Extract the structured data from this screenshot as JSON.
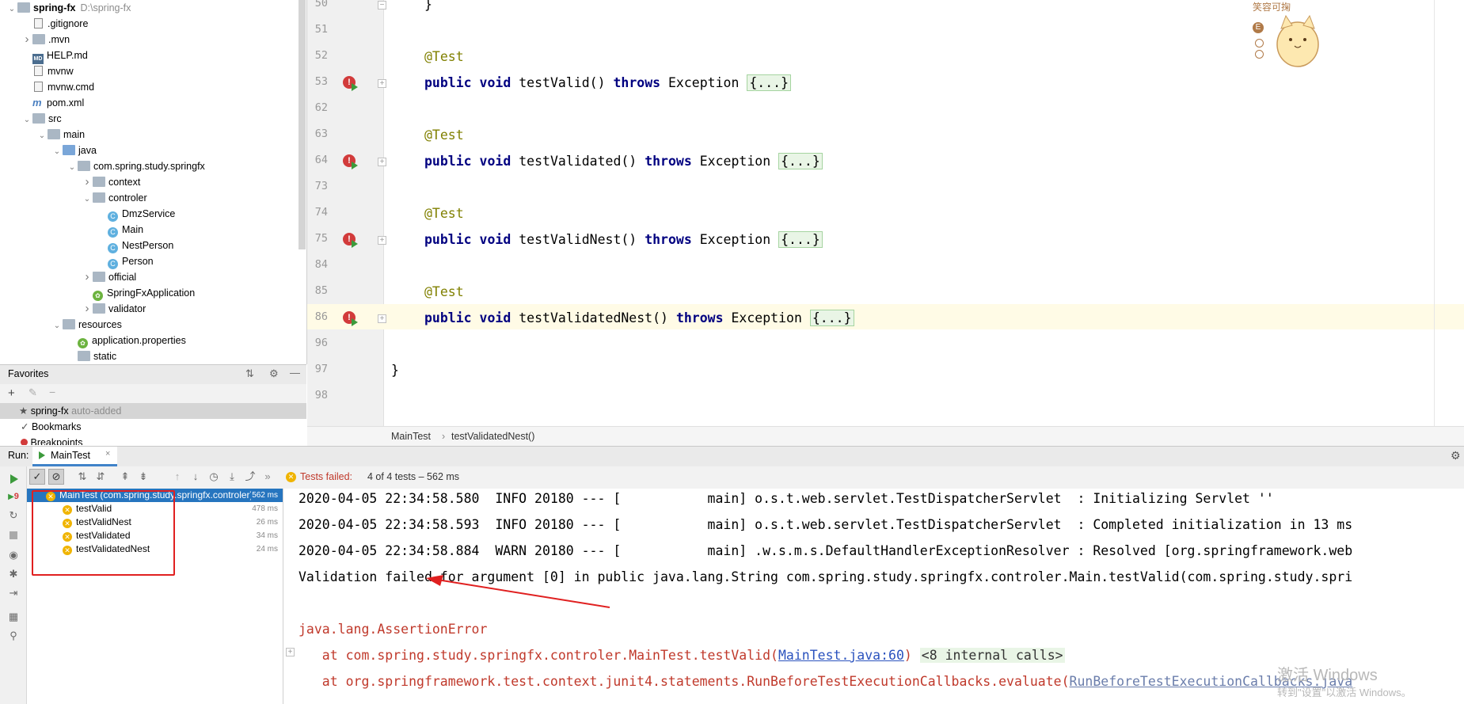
{
  "project_tree": [
    {
      "label": "spring-fx",
      "extra": "D:\\spring-fx",
      "depth": 0,
      "expand": "open",
      "icon": "folder"
    },
    {
      "label": ".gitignore",
      "depth": 1,
      "expand": "",
      "icon": "file"
    },
    {
      "label": ".mvn",
      "depth": 1,
      "expand": "closed",
      "icon": "folder"
    },
    {
      "label": "HELP.md",
      "depth": 1,
      "expand": "",
      "icon": "md"
    },
    {
      "label": "mvnw",
      "depth": 1,
      "expand": "",
      "icon": "file"
    },
    {
      "label": "mvnw.cmd",
      "depth": 1,
      "expand": "",
      "icon": "file"
    },
    {
      "label": "pom.xml",
      "depth": 1,
      "expand": "",
      "icon": "maven"
    },
    {
      "label": "src",
      "depth": 1,
      "expand": "open",
      "icon": "folder"
    },
    {
      "label": "main",
      "depth": 2,
      "expand": "open",
      "icon": "folder"
    },
    {
      "label": "java",
      "depth": 3,
      "expand": "open",
      "icon": "folder-blue"
    },
    {
      "label": "com.spring.study.springfx",
      "depth": 4,
      "expand": "open",
      "icon": "folder"
    },
    {
      "label": "context",
      "depth": 5,
      "expand": "closed",
      "icon": "folder"
    },
    {
      "label": "controler",
      "depth": 5,
      "expand": "open",
      "icon": "folder"
    },
    {
      "label": "DmzService",
      "depth": 6,
      "expand": "",
      "icon": "class"
    },
    {
      "label": "Main",
      "depth": 6,
      "expand": "",
      "icon": "class"
    },
    {
      "label": "NestPerson",
      "depth": 6,
      "expand": "",
      "icon": "class"
    },
    {
      "label": "Person",
      "depth": 6,
      "expand": "",
      "icon": "class"
    },
    {
      "label": "official",
      "depth": 5,
      "expand": "closed",
      "icon": "folder"
    },
    {
      "label": "SpringFxApplication",
      "depth": 5,
      "expand": "",
      "icon": "spring"
    },
    {
      "label": "validator",
      "depth": 5,
      "expand": "closed",
      "icon": "folder"
    },
    {
      "label": "resources",
      "depth": 3,
      "expand": "open",
      "icon": "folder"
    },
    {
      "label": "application.properties",
      "depth": 4,
      "expand": "",
      "icon": "spring"
    },
    {
      "label": "static",
      "depth": 4,
      "expand": "",
      "icon": "folder"
    }
  ],
  "favorites": {
    "title": "Favorites",
    "items": [
      {
        "label": "spring-fx",
        "extra": "auto-added",
        "icon": "star"
      },
      {
        "label": "Bookmarks",
        "extra": "",
        "icon": "check"
      },
      {
        "label": "Breakpoints",
        "extra": "",
        "icon": "dot"
      }
    ]
  },
  "editor": {
    "lines": [
      {
        "num": "50",
        "code": "}",
        "kind": "plain",
        "fold": "-",
        "indent": 2
      },
      {
        "num": "51",
        "code": "",
        "kind": "plain",
        "fold": "",
        "indent": 0
      },
      {
        "num": "52",
        "code": "@Test",
        "kind": "ann",
        "fold": "",
        "indent": 1
      },
      {
        "num": "53",
        "code": "testValid",
        "kind": "method",
        "fold": "+",
        "indent": 1,
        "error": true
      },
      {
        "num": "62",
        "code": "",
        "kind": "plain",
        "fold": "",
        "indent": 0
      },
      {
        "num": "63",
        "code": "@Test",
        "kind": "ann",
        "fold": "",
        "indent": 1
      },
      {
        "num": "64",
        "code": "testValidated",
        "kind": "method",
        "fold": "+",
        "indent": 1,
        "error": true
      },
      {
        "num": "73",
        "code": "",
        "kind": "plain",
        "fold": "",
        "indent": 0
      },
      {
        "num": "74",
        "code": "@Test",
        "kind": "ann",
        "fold": "",
        "indent": 1
      },
      {
        "num": "75",
        "code": "testValidNest",
        "kind": "method",
        "fold": "+",
        "indent": 1,
        "error": true
      },
      {
        "num": "84",
        "code": "",
        "kind": "plain",
        "fold": "",
        "indent": 0
      },
      {
        "num": "85",
        "code": "@Test",
        "kind": "ann",
        "fold": "",
        "indent": 1
      },
      {
        "num": "86",
        "code": "testValidatedNest",
        "kind": "method",
        "fold": "+",
        "indent": 1,
        "error": true
      },
      {
        "num": "96",
        "code": "",
        "kind": "plain",
        "fold": "",
        "indent": 0
      },
      {
        "num": "97",
        "code": "}",
        "kind": "plain",
        "fold": "",
        "indent": 0
      },
      {
        "num": "98",
        "code": "",
        "kind": "plain",
        "fold": "",
        "indent": 0
      }
    ],
    "kw_public": "public",
    "kw_void": "void",
    "kw_throws": "throws",
    "exception": "Exception",
    "folded": "{...}",
    "mascot_text": "笑容可掬",
    "mascot_badge": "E"
  },
  "breadcrumb": {
    "class": "MainTest",
    "method": "testValidatedNest()"
  },
  "run": {
    "label": "Run:",
    "tab": "MainTest",
    "status": "Tests failed:",
    "status_detail": "4 of 4 tests – 562 ms",
    "side_badge": "9"
  },
  "test_tree": [
    {
      "label": "MainTest (com.spring.study.springfx.controler)",
      "time": "562 ms",
      "root": true
    },
    {
      "label": "testValid",
      "time": "478 ms",
      "root": false
    },
    {
      "label": "testValidNest",
      "time": "26 ms",
      "root": false
    },
    {
      "label": "testValidated",
      "time": "34 ms",
      "root": false
    },
    {
      "label": "testValidatedNest",
      "time": "24 ms",
      "root": false
    }
  ],
  "console": {
    "log1": "2020-04-05 22:34:58.580  INFO 20180 --- [           main] o.s.t.web.servlet.TestDispatcherServlet  : Initializing Servlet ''",
    "log2": "2020-04-05 22:34:58.593  INFO 20180 --- [           main] o.s.t.web.servlet.TestDispatcherServlet  : Completed initialization in 13 ms",
    "log3": "2020-04-05 22:34:58.884  WARN 20180 --- [           main] .w.s.m.s.DefaultHandlerExceptionResolver : Resolved [org.springframework.web",
    "log4": "Validation failed for argument [0] in public java.lang.String com.spring.study.springfx.controler.Main.testValid(com.spring.study.spri",
    "error": "java.lang.AssertionError",
    "at1_prefix": "   at com.spring.study.springfx.controler.MainTest.testValid(",
    "at1_link": "MainTest.java:60",
    "at1_suffix": ")",
    "at1_internal": "<8 internal calls>",
    "at2_prefix": "   at org.springframework.test.context.junit4.statements.RunBeforeTestExecutionCallbacks.evaluate(",
    "at2_link": "RunBeforeTestExecutionCallbacks.java"
  },
  "watermark": {
    "line1": "激活 Windows",
    "line2": "转到\"设置\"以激活 Windows。"
  },
  "colors": {
    "accent": "#2675bf",
    "error": "#d23b3b",
    "annotation_red": "#e02020"
  }
}
